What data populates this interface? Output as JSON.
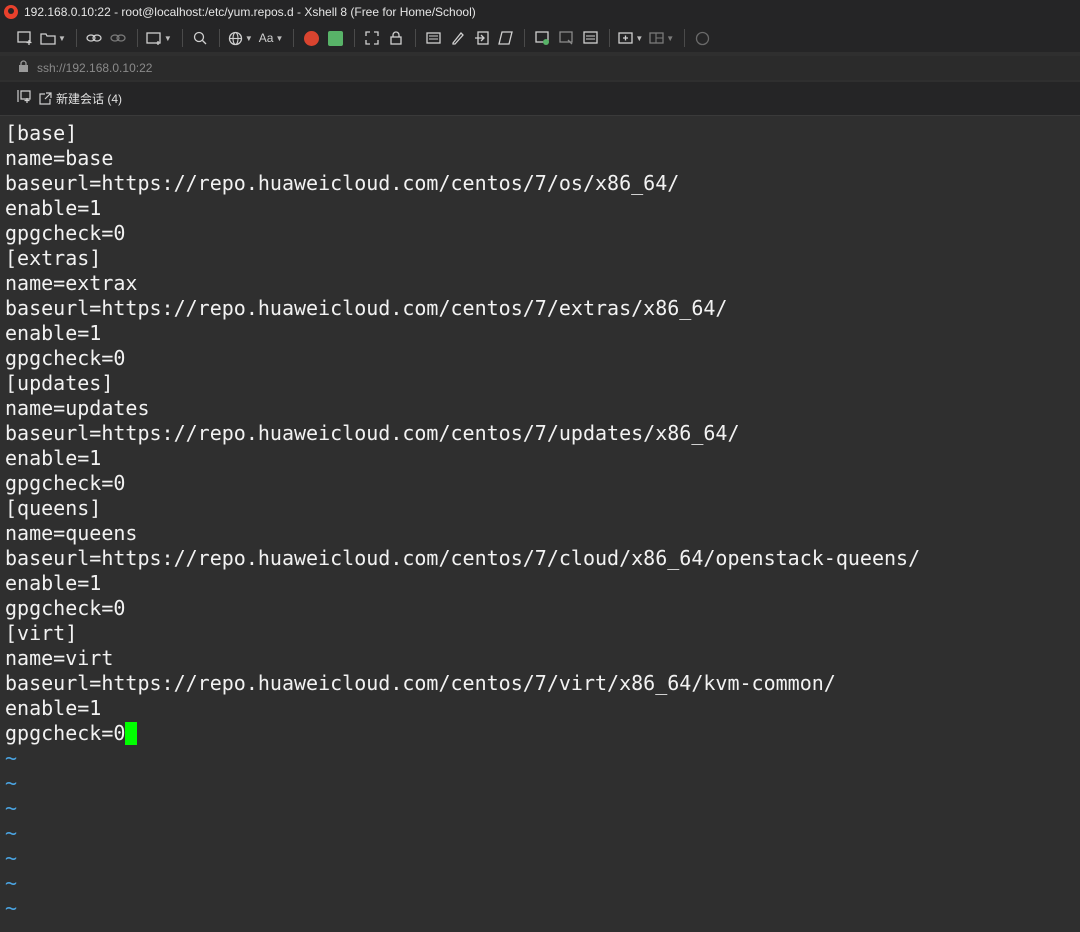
{
  "window": {
    "title": "192.168.0.10:22 - root@localhost:/etc/yum.repos.d - Xshell 8 (Free for Home/School)"
  },
  "addressbar": {
    "address": "ssh://192.168.0.10:22"
  },
  "tabs": [
    {
      "label": "新建会话 (4)"
    }
  ],
  "toolbar": {
    "icons": [
      "new-session-icon",
      "open-folder-icon",
      "connect-icon",
      "disconnect-icon",
      "new-window-icon",
      "find-icon",
      "globe-icon",
      "font-icon",
      "xftp-icon",
      "xmanager-icon",
      "fullscreen-icon",
      "lock-icon",
      "keyboard-icon",
      "highlight-icon",
      "send-icon",
      "script-icon",
      "record-icon",
      "compose-icon",
      "compose-bar-icon",
      "new-tab-icon",
      "layout-icon",
      "chat-icon"
    ]
  },
  "terminal": {
    "lines": [
      "[base]",
      "name=base",
      "baseurl=https://repo.huaweicloud.com/centos/7/os/x86_64/",
      "enable=1",
      "gpgcheck=0",
      "[extras]",
      "name=extrax",
      "baseurl=https://repo.huaweicloud.com/centos/7/extras/x86_64/",
      "enable=1",
      "gpgcheck=0",
      "[updates]",
      "name=updates",
      "baseurl=https://repo.huaweicloud.com/centos/7/updates/x86_64/",
      "enable=1",
      "gpgcheck=0",
      "[queens]",
      "name=queens",
      "baseurl=https://repo.huaweicloud.com/centos/7/cloud/x86_64/openstack-queens/",
      "enable=1",
      "gpgcheck=0",
      "[virt]",
      "name=virt",
      "baseurl=https://repo.huaweicloud.com/centos/7/virt/x86_64/kvm-common/",
      "enable=1",
      "gpgcheck=0"
    ],
    "tilde_lines": [
      "~",
      "~",
      "~",
      "~",
      "~",
      "~",
      "~"
    ],
    "cursor_color": "#00ff00",
    "tilde_color": "#4aa3e0"
  }
}
